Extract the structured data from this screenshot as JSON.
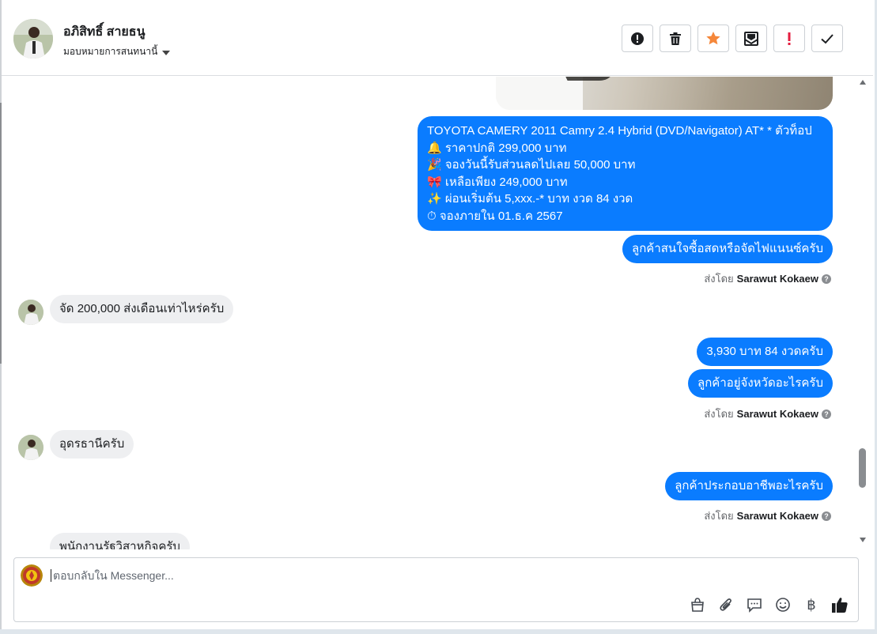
{
  "header": {
    "contact_name": "อภิสิทธิ์ สายธนู",
    "assign_label": "มอบหมายการสนทนานี้",
    "toolbar": [
      {
        "name": "report-spam",
        "icon": "alert-circle-icon"
      },
      {
        "name": "delete",
        "icon": "trash-icon"
      },
      {
        "name": "star",
        "icon": "star-icon",
        "color": "#f5873a"
      },
      {
        "name": "mark-unread",
        "icon": "envelope-icon"
      },
      {
        "name": "mark-important",
        "icon": "exclamation-icon",
        "color": "#e41e3f"
      },
      {
        "name": "mark-done",
        "icon": "check-icon"
      }
    ]
  },
  "thread": {
    "car_listing": [
      "TOYOTA CAMERY 2011 Camry 2.4 Hybrid (DVD/Navigator) AT* * ตัวท็อป",
      "🔔  ราคาปกติ 299,000 บาท",
      "🎉 จองวันนี้รับส่วนลดไปเลย 50,000 บาท",
      "🎀 เหลือเพียง 249,000 บาท",
      "✨ ผ่อนเริ่มต้น 5,xxx.-* บาท งวด 84 งวด",
      "⏱ จองภายใน 01.ธ.ค 2567"
    ],
    "msg_ask_finance": "ลูกค้าสนใจซื้อสดหรือจัดไฟแนนซ์ครับ",
    "sent_by_prefix": "ส่งโดย",
    "agent_name": "Sarawut Kokaew",
    "help_glyph": "?",
    "msg_customer_1": "จัด 200,000 ส่งเดือนเท่าไหร่ครับ",
    "msg_installment": "3,930 บาท 84 งวดครับ",
    "msg_ask_province": "ลูกค้าอยู่จังหวัดอะไรครับ",
    "msg_customer_2": "อุดรธานีครับ",
    "msg_ask_job": "ลูกค้าประกอบอาชีพอะไรครับ",
    "msg_customer_3_partial": "พนักงานรัฐวิสาหกิจครับ"
  },
  "composer": {
    "placeholder": "ตอบกลับใน Messenger...",
    "icons": [
      "shopping-bag-icon",
      "paperclip-icon",
      "saved-replies-icon",
      "emoji-icon",
      "baht-icon",
      "thumbs-up-icon"
    ],
    "baht_glyph": "฿"
  },
  "colors": {
    "outgoing_bubble": "#0a7cff",
    "incoming_bubble": "#eeeff1",
    "star": "#f5873a",
    "important": "#e41e3f"
  }
}
